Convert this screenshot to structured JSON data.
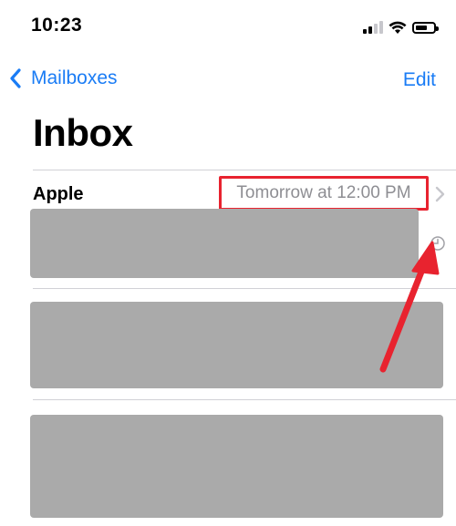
{
  "status_bar": {
    "time": "10:23",
    "icons": [
      "cellular-signal-icon",
      "wifi-icon",
      "battery-icon"
    ]
  },
  "nav": {
    "back_label": "Mailboxes",
    "edit_label": "Edit",
    "title": "Inbox"
  },
  "messages": [
    {
      "sender": "Apple",
      "timestamp": "Tomorrow at 12:00 PM",
      "scheduled": true,
      "preview_redacted": true
    },
    {
      "sender": "",
      "preview_redacted": true
    },
    {
      "sender": "",
      "preview_redacted": true
    }
  ],
  "colors": {
    "accent": "#1a7cf5",
    "highlight_box": "#e8232f",
    "annotation_arrow": "#e8232f",
    "redaction": "#aaaaaa",
    "secondary_text": "#8e8e93",
    "separator": "#d1d1d6"
  },
  "annotation": {
    "type": "arrow",
    "points_to": "scheduled-icon"
  }
}
